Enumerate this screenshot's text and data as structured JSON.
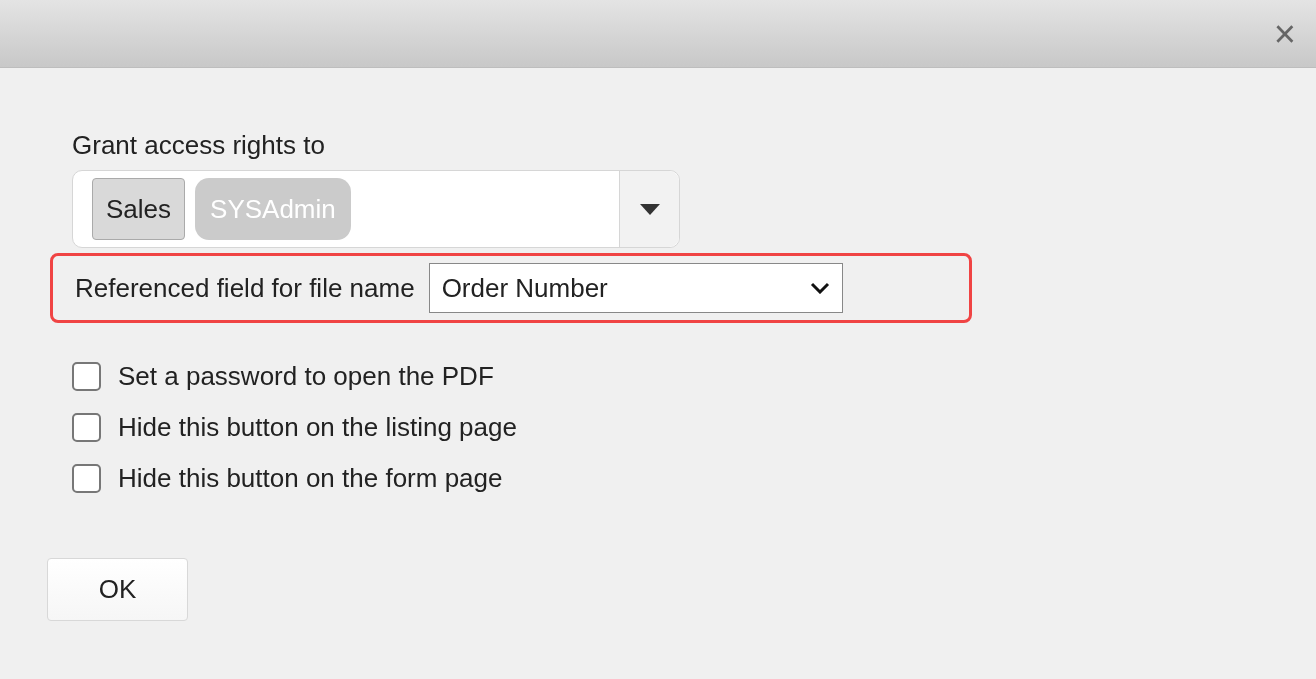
{
  "dialog": {
    "close": "×"
  },
  "access": {
    "label": "Grant access rights to",
    "tags": [
      {
        "text": "Sales",
        "disabled": false
      },
      {
        "text": "SYSAdmin",
        "disabled": true
      }
    ]
  },
  "file_name_field": {
    "label": "Referenced field for file name",
    "value": "Order Number",
    "highlighted": true
  },
  "options": [
    {
      "label": "Set a password to open the PDF",
      "checked": false
    },
    {
      "label": "Hide this button on the listing page",
      "checked": false
    },
    {
      "label": "Hide this button on the form page",
      "checked": false
    }
  ],
  "buttons": [
    "OK"
  ]
}
